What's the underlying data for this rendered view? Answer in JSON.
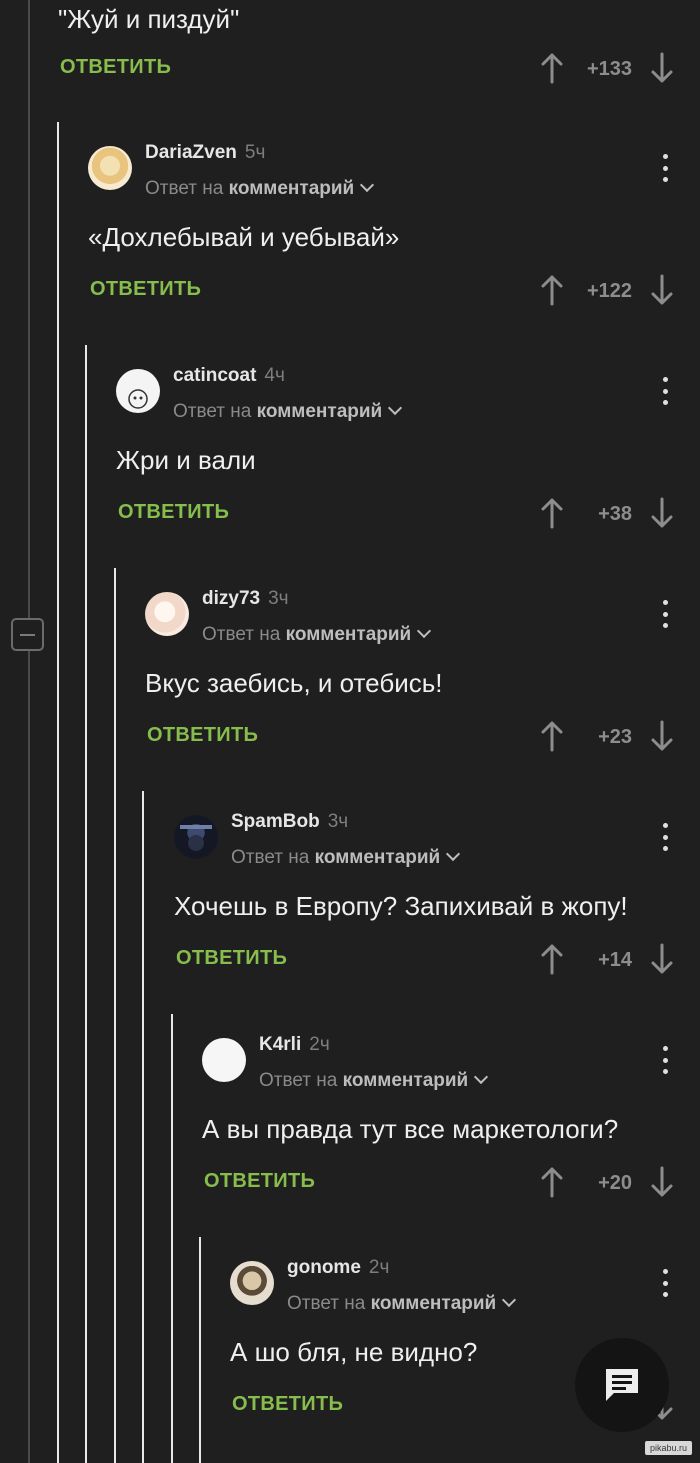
{
  "top_comment": {
    "text": "\"Жуй и пиздуй\"",
    "reply_label": "ОТВЕТИТЬ",
    "score": "+133"
  },
  "comments": [
    {
      "username": "DariaZven",
      "time": "5ч",
      "reply_prefix": "Ответ на",
      "reply_target": "комментарий",
      "text": "«Дохлебывай и уебывай»",
      "reply_label": "ОТВЕТИТЬ",
      "score": "+122"
    },
    {
      "username": "catincoat",
      "time": "4ч",
      "reply_prefix": "Ответ на",
      "reply_target": "комментарий",
      "text": "Жри и вали",
      "reply_label": "ОТВЕТИТЬ",
      "score": "+38"
    },
    {
      "username": "dizy73",
      "time": "3ч",
      "reply_prefix": "Ответ на",
      "reply_target": "комментарий",
      "text": "Вкус заебись, и отебись!",
      "reply_label": "ОТВЕТИТЬ",
      "score": "+23"
    },
    {
      "username": "SpamBob",
      "time": "3ч",
      "reply_prefix": "Ответ на",
      "reply_target": "комментарий",
      "text": "Хочешь в Европу? Запихивай в жопу!",
      "reply_label": "ОТВЕТИТЬ",
      "score": "+14"
    },
    {
      "username": "K4rli",
      "time": "2ч",
      "reply_prefix": "Ответ на",
      "reply_target": "комментарий",
      "text": "А вы правда тут все маркетологи?",
      "reply_label": "ОТВЕТИТЬ",
      "score": "+20"
    },
    {
      "username": "gonome",
      "time": "2ч",
      "reply_prefix": "Ответ на",
      "reply_target": "комментарий",
      "text": "А шо бля, не видно?",
      "reply_label": "ОТВЕТИТЬ",
      "score": ""
    }
  ],
  "watermark": "pikabu.ru",
  "icons": {
    "upvote": "arrow-up-icon",
    "downvote": "arrow-down-icon",
    "menu": "kebab-menu-icon",
    "collapse": "minus-icon",
    "compose": "comment-icon"
  },
  "colors": {
    "background": "#1f1f1f",
    "accent_green": "#87bd4c",
    "thread_line": "#e8e8e8",
    "muted_text": "#8a8a8a"
  }
}
